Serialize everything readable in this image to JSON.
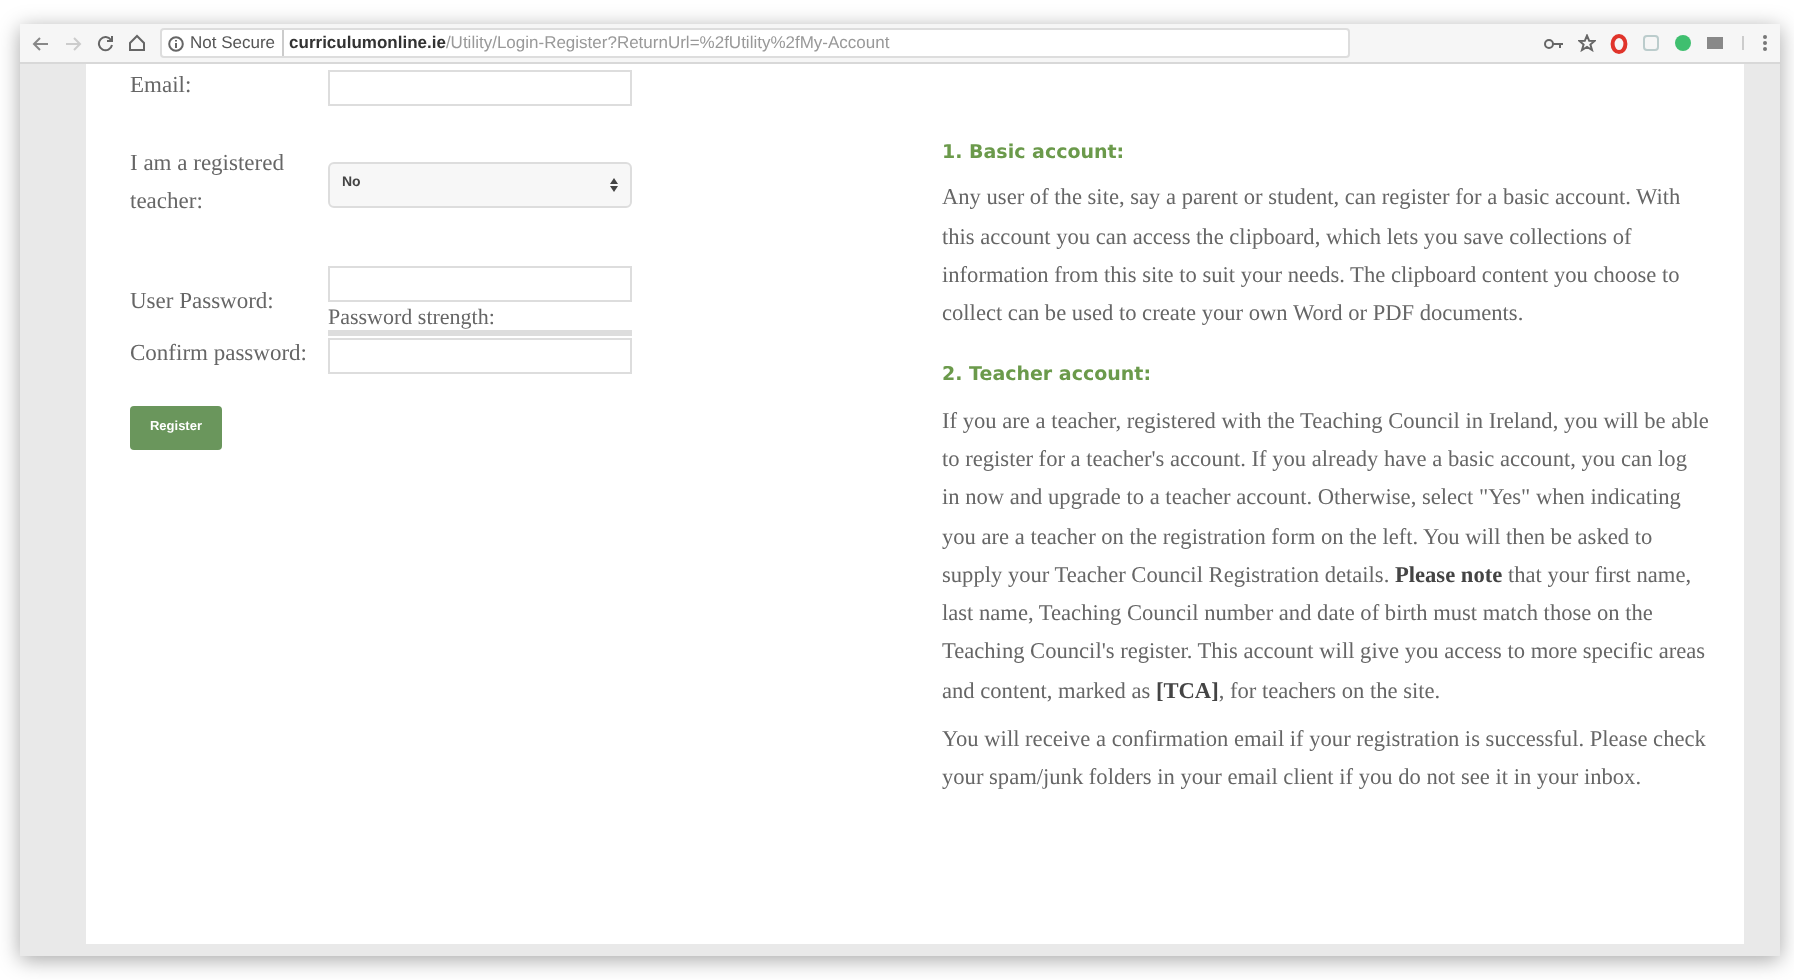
{
  "browser": {
    "security": "Not Secure",
    "domain": "curriculumonline.ie",
    "path": "/Utility/Login-Register?ReturnUrl=%2fUtility%2fMy-Account"
  },
  "form": {
    "fields": [
      {
        "kind": "text",
        "label": "Email:"
      },
      {
        "kind": "select",
        "label": "I am a registered teacher:",
        "value": "No"
      },
      {
        "kind": "password",
        "label": "User Password:",
        "note": "Password strength:"
      },
      {
        "kind": "password",
        "label": "Confirm password:"
      }
    ],
    "submit": "Register"
  },
  "info": {
    "sections": [
      {
        "heading": "1. Basic account:",
        "paragraphs": [
          "Any user of the site, say a parent or student, can register for a basic account. With this account you can access the clipboard, which lets you save collections of information from this site to suit your needs. The clipboard content you choose to collect can be used to create your own Word or PDF documents."
        ]
      },
      {
        "heading": "2. Teacher account:",
        "paragraphs": [
          "If you are a teacher, registered with the Teaching Council in Ireland, you will be able to register for a teacher's account. If you already have a basic account, you can log in now and upgrade to a teacher account. Otherwise, select \"Yes\" when indicating you are a teacher on the registration form on the left. You will then be asked to supply your Teacher Council Registration details. **Please note** that your first name, last name, Teaching Council number and date of birth must match those on the Teaching Council's register. This account will give you access to more specific areas and content, marked as **[TCA]**, for teachers on the site.",
          "You will receive a confirmation email if your registration is successful. Please check your spam/junk folders in your email client if you do not see it in your inbox."
        ]
      }
    ]
  }
}
